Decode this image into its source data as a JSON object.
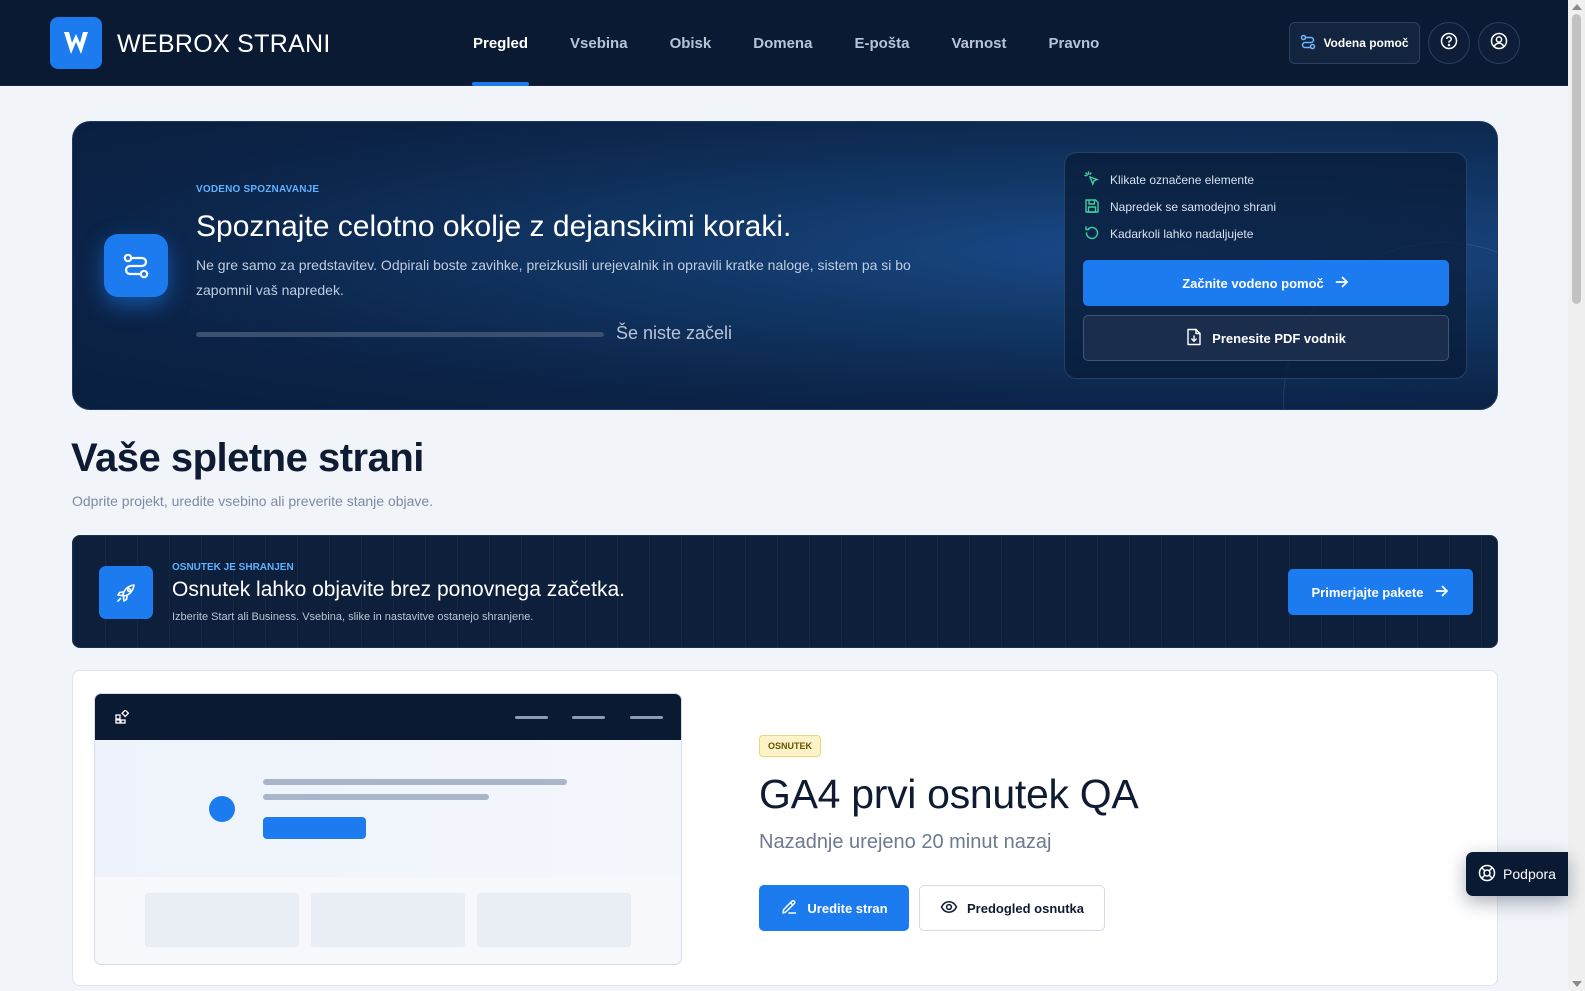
{
  "header": {
    "brand": "WEBROX STRANI",
    "nav": [
      {
        "label": "Pregled",
        "active": true
      },
      {
        "label": "Vsebina",
        "active": false
      },
      {
        "label": "Obisk",
        "active": false
      },
      {
        "label": "Domena",
        "active": false
      },
      {
        "label": "E-pošta",
        "active": false
      },
      {
        "label": "Varnost",
        "active": false
      },
      {
        "label": "Pravno",
        "active": false
      }
    ],
    "guide_button": "Vodena pomoč",
    "help_icon": "help-circle-icon",
    "account_icon": "user-circle-icon"
  },
  "onboarding": {
    "eyebrow": "VODENO SPOZNAVANJE",
    "title": "Spoznajte celotno okolje z dejanskimi koraki.",
    "description": "Ne gre samo za predstavitev. Odpirali boste zavihke, preizkusili urejevalnik in opravili kratke naloge, sistem pa si bo zapomnil vaš napredek.",
    "progress_percent": 0,
    "progress_text": "Še niste začeli",
    "checklist": [
      {
        "icon": "pointer-click-icon",
        "label": "Klikate označene elemente"
      },
      {
        "icon": "save-icon",
        "label": "Napredek se samodejno shrani"
      },
      {
        "icon": "refresh-icon",
        "label": "Kadarkoli lahko nadaljujete"
      }
    ],
    "start_button": "Začnite vodeno pomoč",
    "pdf_button": "Prenesite PDF vodnik"
  },
  "sites_section": {
    "title": "Vaše spletne strani",
    "subtitle": "Odprite projekt, uredite vsebino ali preverite stanje objave."
  },
  "draft_banner": {
    "eyebrow": "OSNUTEK JE SHRANJEN",
    "title": "Osnutek lahko objavite brez ponovnega začetka.",
    "description": "Izberite Start ali Business. Vsebina, slike in nastavitve ostanejo shranjene.",
    "button": "Primerjajte pakete"
  },
  "project": {
    "status": "OSNUTEK",
    "title": "GA4 prvi osnutek QA",
    "last_edited": "Nazadnje urejeno 20 minut nazaj",
    "edit_button": "Uredite stran",
    "preview_button": "Predogled osnutka"
  },
  "support": {
    "label": "Podpora"
  },
  "colors": {
    "accent": "#1d7bf0",
    "navy": "#0b1a33",
    "check_green": "#3fd0a0",
    "eyebrow_blue": "#5fb0ff"
  }
}
